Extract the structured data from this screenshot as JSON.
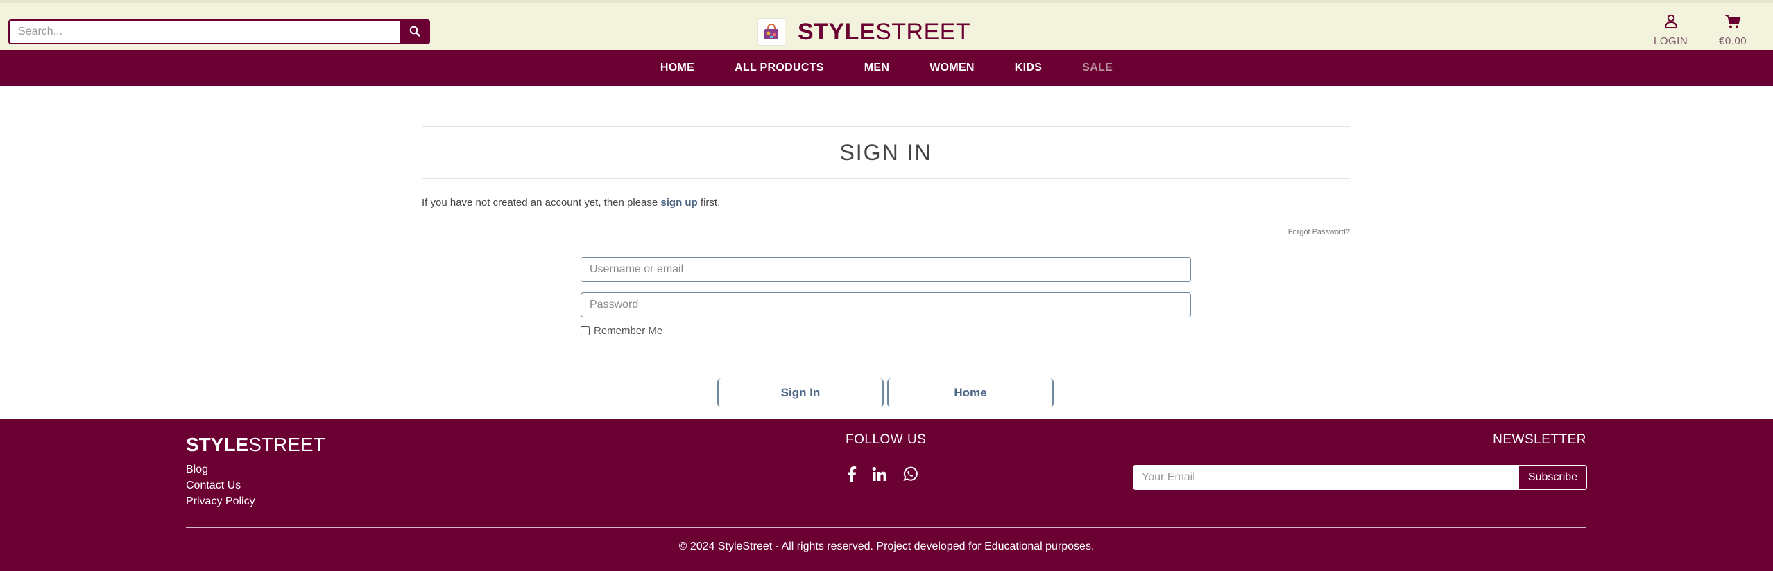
{
  "header": {
    "search": {
      "placeholder": "Search..."
    },
    "brand": {
      "bold": "STYLE",
      "light": "STREET"
    },
    "account": {
      "login_label": "LOGIN",
      "cart_total": "€0.00"
    }
  },
  "nav": {
    "items": [
      {
        "label": "HOME"
      },
      {
        "label": "ALL PRODUCTS"
      },
      {
        "label": "MEN"
      },
      {
        "label": "WOMEN"
      },
      {
        "label": "KIDS"
      },
      {
        "label": "SALE"
      }
    ]
  },
  "main": {
    "title": "SIGN IN",
    "intro_before": "If you have not created an account yet, then please ",
    "intro_link": "sign up",
    "intro_after": " first.",
    "forgot": "Forgot Password?",
    "username_placeholder": "Username or email",
    "password_placeholder": "Password",
    "remember_label": "Remember Me",
    "signin_button": "Sign In",
    "home_button": "Home"
  },
  "footer": {
    "brand": {
      "bold": "STYLE",
      "light": "STREET"
    },
    "links": [
      {
        "label": "Blog"
      },
      {
        "label": "Contact Us"
      },
      {
        "label": "Privacy Policy"
      }
    ],
    "follow_title": "FOLLOW US",
    "newsletter_title": "NEWSLETTER",
    "email_placeholder": "Your Email",
    "subscribe_label": "Subscribe",
    "copyright": "© 2024 StyleStreet - All rights reserved. Project developed for Educational purposes."
  },
  "colors": {
    "brand": "#6b0033",
    "topbar_bg": "#f3f3dd",
    "link": "#4b6584"
  }
}
